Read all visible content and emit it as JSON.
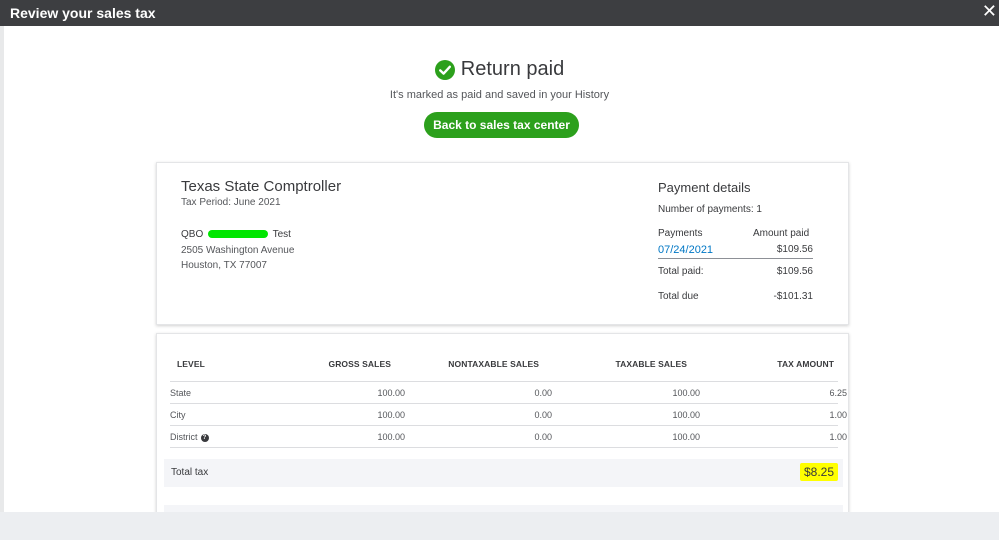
{
  "window": {
    "title": "Review your sales tax",
    "close_glyph": "✕"
  },
  "status": {
    "heading": "Return paid",
    "subtext": "It's marked as paid and saved in your History",
    "icon": "check-circle-icon",
    "accent_color": "#2ca01c"
  },
  "actions": {
    "back_label": "Back to sales tax center"
  },
  "agency": {
    "name": "Texas State Comptroller",
    "tax_period": "Tax Period: June 2021",
    "company_prefix": "QBO",
    "company_suffix": "Test",
    "address_line1": "2505 Washington Avenue",
    "address_line2": "Houston, TX 77007"
  },
  "payment_details": {
    "title": "Payment details",
    "number_of_payments": "Number of payments: 1",
    "payments_header": "Payments",
    "amount_header": "Amount paid",
    "payments": [
      {
        "date": "07/24/2021",
        "amount": "$109.56"
      }
    ],
    "total_paid_label": "Total paid:",
    "total_paid_value": "$109.56",
    "total_due_label": "Total due",
    "total_due_value": "-$101.31"
  },
  "tax_table": {
    "headers": [
      "LEVEL",
      "GROSS SALES",
      "NONTAXABLE SALES",
      "TAXABLE SALES",
      "TAX AMOUNT"
    ],
    "rows": [
      {
        "level": "State",
        "gross": "100.00",
        "nontaxable": "0.00",
        "taxable": "100.00",
        "tax": "6.25"
      },
      {
        "level": "City",
        "gross": "100.00",
        "nontaxable": "0.00",
        "taxable": "100.00",
        "tax": "1.00"
      },
      {
        "level": "District",
        "gross": "100.00",
        "nontaxable": "0.00",
        "taxable": "100.00",
        "tax": "1.00"
      }
    ],
    "total_label": "Total tax",
    "total_value": "$8.25",
    "highlight_color": "#ffff00"
  }
}
